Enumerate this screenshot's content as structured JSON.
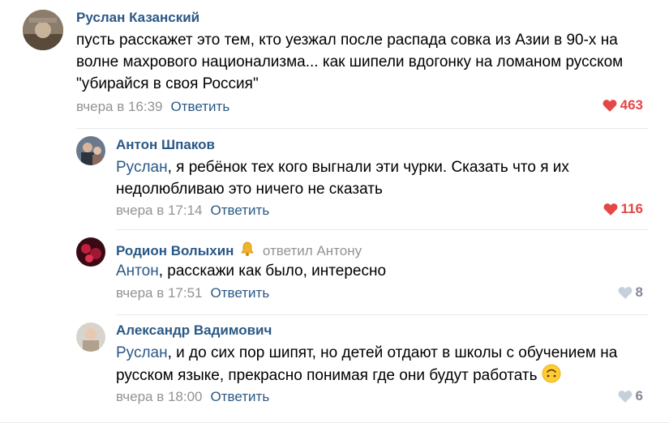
{
  "colors": {
    "link": "#2a5885",
    "meta": "#939393",
    "like_active": "#e64646",
    "like_inactive": "#c5d0db",
    "divider": "#e7e8ec"
  },
  "comments": [
    {
      "author": "Руслан Казанский",
      "text": "пусть расскажет это тем, кто уезжал после распада совка из Азии в 90-х на волне махрового национализма... как шипели вдогонку на ломаном русском \"убирайся в своя Россия\"",
      "date": "вчера в 16:39",
      "reply_label": "Ответить",
      "likes": "463",
      "liked": true
    },
    {
      "author": "Антон Шпаков",
      "mention": "Руслан",
      "text": ", я ребёнок тех кого выгнали эти чурки. Сказать что я их недолюбливаю это ничего не сказать",
      "date": "вчера в 17:14",
      "reply_label": "Ответить",
      "likes": "116",
      "liked": true
    },
    {
      "author": "Родион Волыхин",
      "author_icon": "bell-icon",
      "reply_to": "ответил Антону",
      "mention": "Антон",
      "text": ", расскажи как было, интересно",
      "date": "вчера в 17:51",
      "reply_label": "Ответить",
      "likes": "8",
      "liked": false
    },
    {
      "author": "Александр Вадимович",
      "mention": "Руслан",
      "text": ", и до сих пор шипят, но детей отдают в школы с обучением на русском языке, прекрасно понимая где они будут работать",
      "emoji": "upside-down-face-emoji",
      "date": "вчера в 18:00",
      "reply_label": "Ответить",
      "likes": "6",
      "liked": false
    }
  ]
}
